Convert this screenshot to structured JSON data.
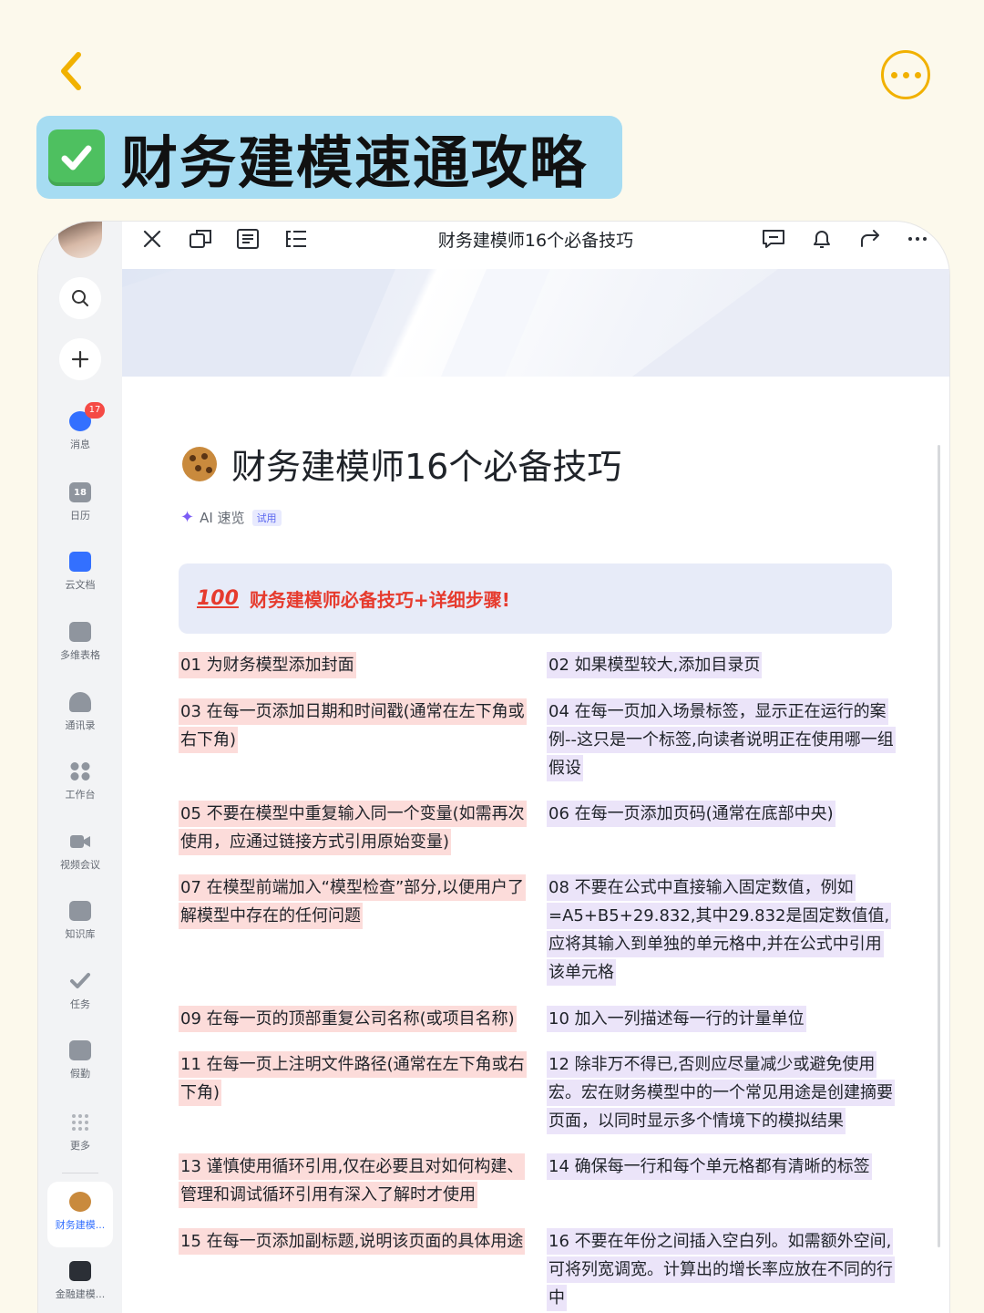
{
  "page": {
    "banner_title": "财务建模速通攻略",
    "icons": {
      "back": "chevron-left-icon",
      "more": "more-icon",
      "check": "check-icon"
    },
    "accent_color": "#f1b100",
    "banner_color": "#a6dcf2"
  },
  "sidebar": {
    "items": [
      {
        "label": "消息",
        "badge": "17"
      },
      {
        "label": "日历",
        "icon_text": "18"
      },
      {
        "label": "云文档"
      },
      {
        "label": "多维表格"
      },
      {
        "label": "通讯录"
      },
      {
        "label": "工作台"
      },
      {
        "label": "视频会议"
      },
      {
        "label": "知识库"
      },
      {
        "label": "任务"
      },
      {
        "label": "假勤"
      },
      {
        "label": "更多"
      },
      {
        "label": "财务建模..."
      },
      {
        "label": "金融建模..."
      }
    ]
  },
  "toolbar": {
    "title": "财务建模师16个必备技巧"
  },
  "doc": {
    "heading": "财务建模师16个必备技巧",
    "ai_label": "AI 速览",
    "trial_badge": "试用",
    "callout_icon": "100",
    "callout_text": "财务建模师必备技巧+详细步骤!",
    "tips": [
      "01 为财务模型添加封面",
      "02 如果模型较大,添加目录页",
      "03 在每一页添加日期和时间戳(通常在左下角或右下角)",
      "04 在每一页加入场景标签，显示正在运行的案例--这只是一个标签,向读者说明正在使用哪一组假设",
      "05 不要在模型中重复输入同一个变量(如需再次使用，应通过链接方式引用原始变量)",
      "06 在每一页添加页码(通常在底部中央)",
      "07 在模型前端加入“模型检查”部分,以便用户了解模型中存在的任何问题",
      "08 不要在公式中直接输入固定数值，例如=A5+B5+29.832,其中29.832是固定数值值,应将其输入到单独的单元格中,并在公式中引用该单元格",
      "09 在每一页的顶部重复公司名称(或项目名称)",
      "10 加入一列描述每一行的计量单位",
      "11 在每一页上注明文件路径(通常在左下角或右下角)",
      "12 除非万不得已,否则应尽量减少或避免使用宏。宏在财务模型中的一个常见用途是创建摘要页面，以同时显示多个情境下的模拟结果",
      "13 谨慎使用循环引用,仅在必要且对如何构建、管理和调试循环引用有深入了解时才使用",
      "14 确保每一行和每个单元格都有清晰的标签",
      "15 在每一页添加副标题,说明该页面的具体用途",
      "16 不要在年份之间插入空白列。如需额外空间,可将列宽调宽。计算出的增长率应放在不同的行中"
    ]
  }
}
